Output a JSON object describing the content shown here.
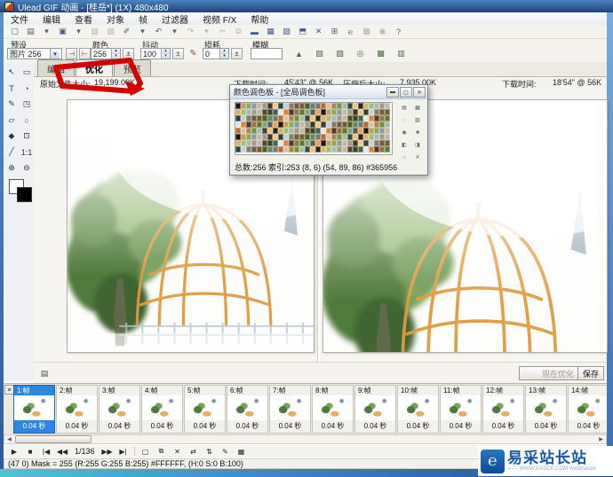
{
  "icons": {
    "dropdown": "▾",
    "close": "✕",
    "minimize": "▬",
    "maximize": "▢",
    "scroll_left": "◀",
    "scroll_right": "▶",
    "app_glyph": "◩",
    "timeline_close": "✕",
    "collapse_glyph": "▤"
  },
  "window": {
    "title": "Ulead GIF 动画 - [桂岳*] (1X) 480x480"
  },
  "menu": {
    "items": [
      {
        "name": "menu-file",
        "label": "文件"
      },
      {
        "name": "menu-edit",
        "label": "编辑"
      },
      {
        "name": "menu-view",
        "label": "查看"
      },
      {
        "name": "menu-object",
        "label": "对象"
      },
      {
        "name": "menu-frame",
        "label": "帧"
      },
      {
        "name": "menu-filter",
        "label": "过滤器"
      },
      {
        "name": "menu-video-fx",
        "label": "视频 F/X"
      },
      {
        "name": "menu-help",
        "label": "帮助"
      }
    ]
  },
  "toolbar": {
    "icons": [
      {
        "name": "new-icon",
        "glyph": "▢"
      },
      {
        "name": "open-icon",
        "glyph": "▤"
      },
      {
        "name": "open-dropdown-icon",
        "glyph": "▾"
      },
      {
        "name": "save-icon",
        "glyph": "▣"
      },
      {
        "name": "save-dropdown-icon",
        "glyph": "▾"
      },
      {
        "name": "print-icon",
        "glyph": "▥",
        "disabled": true
      },
      {
        "name": "export-icon",
        "glyph": "▧",
        "disabled": true
      },
      {
        "name": "wand-icon",
        "glyph": "✐"
      },
      {
        "name": "wand-dropdown-icon",
        "glyph": "▾"
      },
      {
        "name": "undo-icon",
        "glyph": "↶"
      },
      {
        "name": "undo-dropdown-icon",
        "glyph": "▾"
      },
      {
        "name": "redo-icon",
        "glyph": "↷",
        "disabled": true
      },
      {
        "name": "redo-dropdown-icon",
        "glyph": "▾",
        "disabled": true
      },
      {
        "name": "cut-icon",
        "glyph": "✂",
        "disabled": true
      },
      {
        "name": "copy-icon",
        "glyph": "⧉",
        "disabled": true
      },
      {
        "name": "paste-icon",
        "glyph": "▬"
      },
      {
        "name": "add-image-icon",
        "glyph": "▦"
      },
      {
        "name": "add-banner-icon",
        "glyph": "▨"
      },
      {
        "name": "duplicate-object-icon",
        "glyph": "⬒"
      },
      {
        "name": "delete-object-icon",
        "glyph": "✕"
      },
      {
        "name": "crop-canvas-icon",
        "glyph": "⊞"
      },
      {
        "name": "internet-icon",
        "glyph": "℮"
      },
      {
        "name": "preview-browser-icon",
        "glyph": "▩",
        "disabled": true
      },
      {
        "name": "properties-icon",
        "glyph": "◉",
        "disabled": true
      },
      {
        "name": "help-icon",
        "glyph": "?"
      }
    ]
  },
  "optimize_bar": {
    "preset_label": "预设",
    "preset_value": "图片 256",
    "color_label": "颜色",
    "color_value": "256",
    "dither_label": "抖动",
    "dither_value": "100",
    "loss_label": "损耗",
    "loss_value": "0",
    "blur_label": "模糊",
    "blur_value": "",
    "mini_buttons": [
      {
        "name": "preset-save-icon",
        "glyph": "⊣",
        "disabled": true
      },
      {
        "name": "preset-delete-icon",
        "glyph": "⊢"
      }
    ],
    "trail_icons": [
      {
        "name": "add-to-palette-icon",
        "glyph": "▲"
      },
      {
        "name": "mask-area-icon",
        "glyph": "▨"
      },
      {
        "name": "palette-mask-icon",
        "glyph": "▧"
      },
      {
        "name": "magnify-view-icon",
        "glyph": "◎"
      },
      {
        "name": "palette-colors-icon",
        "glyph": "▩"
      },
      {
        "name": "reduce-colors-icon",
        "glyph": "▥"
      }
    ]
  },
  "tabs": {
    "items": [
      {
        "name": "tab-edit",
        "label": "编辑"
      },
      {
        "name": "tab-optimize",
        "label": "优化",
        "active": true
      },
      {
        "name": "tab-preview",
        "label": "预览"
      }
    ]
  },
  "info_bar": {
    "original_label": "原始文件大小:",
    "original_value": "19,199.00K",
    "download_left_label": "下载时间:",
    "download_left_value": "45'43\" @ 56K",
    "compressed_label": "压缩后大小:",
    "compressed_value": "7,935.00K",
    "download_right_label": "下载时间:",
    "download_right_value": "18'54\" @ 56K"
  },
  "tools": {
    "items": [
      {
        "name": "pick-tool",
        "glyph": "↖"
      },
      {
        "name": "object-select-tool",
        "glyph": "▭"
      },
      {
        "name": "text-tool",
        "glyph": "T"
      },
      {
        "name": "timer-tool",
        "glyph": "◔"
      },
      {
        "name": "brush-tool",
        "glyph": "✎"
      },
      {
        "name": "crop-tool",
        "glyph": "◳"
      },
      {
        "name": "eraser-tool",
        "glyph": "▱"
      },
      {
        "name": "lasso-tool",
        "glyph": "○"
      },
      {
        "name": "fill-tool",
        "glyph": "◆"
      },
      {
        "name": "zoom-select-tool",
        "glyph": "⊡"
      },
      {
        "name": "line-tool",
        "glyph": "╱"
      },
      {
        "name": "actual-size-tool",
        "glyph": "1:1"
      },
      {
        "name": "zoom-in-tool",
        "glyph": "⊕"
      },
      {
        "name": "zoom-out-tool",
        "glyph": "⊖"
      }
    ]
  },
  "palette_dialog": {
    "title": "颜色调色板 - [全局调色板]",
    "status": "总数:256 索引:253 (8, 6) (54, 89, 86) #365956",
    "side_icons": [
      {
        "name": "sort-palette-icon",
        "glyph": "▤"
      },
      {
        "name": "grid-view-icon",
        "glyph": "▦"
      },
      {
        "name": "refresh-palette-icon",
        "glyph": "◌"
      },
      {
        "name": "open-palette-icon",
        "glyph": "▧"
      },
      {
        "name": "lock-color-icon",
        "glyph": "◉"
      },
      {
        "name": "stop-icon",
        "glyph": "■"
      },
      {
        "name": "swap-colors-icon",
        "glyph": "◧"
      },
      {
        "name": "invert-colors-icon",
        "glyph": "◨"
      },
      {
        "name": "sync-palette-icon",
        "glyph": "○"
      },
      {
        "name": "delete-color-icon",
        "glyph": "✕"
      }
    ],
    "colors": [
      "#161616",
      "#2b2318",
      "#43331c",
      "#5d4423",
      "#7a5a2b",
      "#96713a",
      "#b08648",
      "#c79a55",
      "#dcb06a",
      "#e9c788",
      "#32491f",
      "#46611f",
      "#59792c",
      "#6f9440",
      "#87ab58",
      "#9fc06f",
      "#2e4034",
      "#49634b",
      "#688265",
      "#87a083",
      "#a5bca0",
      "#8d9aa6",
      "#aab6c0",
      "#c5ced6",
      "#e0e5ea",
      "#707a70",
      "#555e55",
      "#3c443c",
      "#c7b89a",
      "#a99a7c",
      "#8a7a5e",
      "#d8863a",
      "#c06a2a",
      "#e8a14e",
      "#f4bf72",
      "#9a9a8e",
      "#b8b8ac",
      "#6a5a4a",
      "#4a3a2e",
      "#d0c4b0"
    ]
  },
  "actions": {
    "optimize_now": "现在优化",
    "save": "保存"
  },
  "timeline": {
    "frames": [
      {
        "label": "1:帧",
        "duration": "0.04 秒",
        "selected": true
      },
      {
        "label": "2:帧",
        "duration": "0.04 秒"
      },
      {
        "label": "3:帧",
        "duration": "0.04 秒"
      },
      {
        "label": "4:帧",
        "duration": "0.04 秒"
      },
      {
        "label": "5:帧",
        "duration": "0.04 秒"
      },
      {
        "label": "6:帧",
        "duration": "0.04 秒"
      },
      {
        "label": "7:帧",
        "duration": "0.04 秒"
      },
      {
        "label": "8:帧",
        "duration": "0.04 秒"
      },
      {
        "label": "9:帧",
        "duration": "0.04 秒"
      },
      {
        "label": "10:帧",
        "duration": "0.04 秒"
      },
      {
        "label": "11:帧",
        "duration": "0.04 秒"
      },
      {
        "label": "12:帧",
        "duration": "0.04 秒"
      },
      {
        "label": "13:帧",
        "duration": "0.04 秒"
      },
      {
        "label": "14:帧",
        "duration": "0.04 秒"
      }
    ]
  },
  "playbar": {
    "counter": "1/136",
    "transport": [
      {
        "name": "play-button",
        "glyph": "▶"
      },
      {
        "name": "stop-button",
        "glyph": "■",
        "disabled": true
      },
      {
        "name": "first-frame-button",
        "glyph": "|◀"
      },
      {
        "name": "prev-frame-button",
        "glyph": "◀◀"
      }
    ],
    "transport2": [
      {
        "name": "next-frame-button",
        "glyph": "▶▶"
      },
      {
        "name": "last-frame-button",
        "glyph": "▶|"
      }
    ],
    "edit_icons": [
      {
        "name": "add-frame-icon",
        "glyph": "▢"
      },
      {
        "name": "duplicate-frame-icon",
        "glyph": "⧉"
      },
      {
        "name": "delete-frame-icon",
        "glyph": "✕"
      },
      {
        "name": "reverse-frames-icon",
        "glyph": "⇄",
        "disabled": true
      },
      {
        "name": "move-frame-icon",
        "glyph": "⇅",
        "disabled": true
      },
      {
        "name": "tween-icon",
        "glyph": "✎",
        "disabled": true
      },
      {
        "name": "frame-layout-icon",
        "glyph": "▦"
      }
    ]
  },
  "status_bar": {
    "text": "(47 0) Mask = 255 (R:255 G:255 B:255) #FFFFFF, (H:0 S:0 B:100)"
  },
  "watermark": {
    "logo": "℮",
    "text": "易采站长站",
    "subtext": "—— WWW.EASCK.COM Webmaster"
  }
}
